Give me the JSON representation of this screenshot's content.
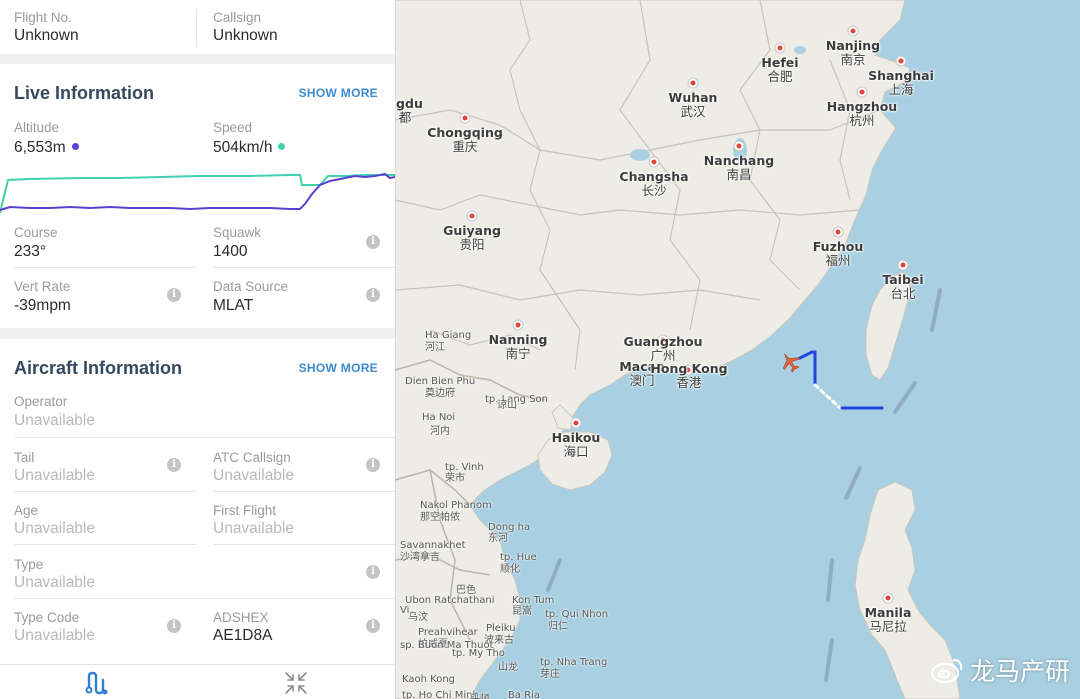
{
  "flight": {
    "flight_no_label": "Flight No.",
    "flight_no_value": "Unknown",
    "callsign_label": "Callsign",
    "callsign_value": "Unknown"
  },
  "live": {
    "title": "Live Information",
    "show_more": "SHOW MORE",
    "altitude_label": "Altitude",
    "altitude_value": "6,553m",
    "speed_label": "Speed",
    "speed_value": "504km/h",
    "altitude_color": "#5b3fd0",
    "speed_color": "#3fd1b0",
    "course_label": "Course",
    "course_value": "233°",
    "squawk_label": "Squawk",
    "squawk_value": "1400",
    "vert_rate_label": "Vert Rate",
    "vert_rate_value": "-39mpm",
    "data_source_label": "Data Source",
    "data_source_value": "MLAT"
  },
  "aircraft": {
    "title": "Aircraft Information",
    "show_more": "SHOW MORE",
    "operator_label": "Operator",
    "operator_value": "Unavailable",
    "tail_label": "Tail",
    "tail_value": "Unavailable",
    "atc_label": "ATC Callsign",
    "atc_value": "Unavailable",
    "age_label": "Age",
    "age_value": "Unavailable",
    "first_flight_label": "First Flight",
    "first_flight_value": "Unavailable",
    "type_label": "Type",
    "type_value": "Unavailable",
    "type_code_label": "Type Code",
    "type_code_value": "Unavailable",
    "adshex_label": "ADSHEX",
    "adshex_value": "AE1D8A"
  },
  "icons": {
    "info": "i",
    "route": "route-icon",
    "collapse": "collapse-icon"
  },
  "map": {
    "cities": [
      {
        "name": "Nanjing",
        "zh": "南京"
      },
      {
        "name": "Hefei",
        "zh": "合肥"
      },
      {
        "name": "Shanghai",
        "zh": "上海"
      },
      {
        "name": "Wuhan",
        "zh": "武汉"
      },
      {
        "name": "Hangzhou",
        "zh": "杭州"
      },
      {
        "name": "Chongqing",
        "zh": "重庆"
      },
      {
        "name": "Nanchang",
        "zh": "南昌"
      },
      {
        "name": "Changsha",
        "zh": "长沙"
      },
      {
        "name": "Guiyang",
        "zh": "贵阳"
      },
      {
        "name": "Fuzhou",
        "zh": "福州"
      },
      {
        "name": "Taibei",
        "zh": "台北"
      },
      {
        "name": "Guangzhou",
        "zh": "广州"
      },
      {
        "name": "Nanning",
        "zh": "南宁"
      },
      {
        "name": "Macao",
        "zh": "澳门"
      },
      {
        "name": "Hong Kong",
        "zh": "香港"
      },
      {
        "name": "Haikou",
        "zh": "海口"
      },
      {
        "name": "Manila",
        "zh": "马尼拉"
      },
      {
        "name": "ngdu",
        "zh": "都"
      }
    ],
    "small_labels": [
      "Ha Giang",
      "河江",
      "Dien Bien Phu",
      "奠边府",
      "Ha Noi",
      "河内",
      "tp. Lang Son",
      "谅山",
      "tp. Vinh",
      "荣市",
      "Nakol Phanom",
      "那空帕侬",
      "Savannakhet",
      "沙湾拿吉",
      "Dong ha",
      "东河",
      "tp. Hue",
      "顺化",
      "Kon Tum",
      "昆嵩",
      "tp. Qui Nhon",
      "归仁",
      "Preahvihear",
      "柏威夏",
      "tp. Nha Trang",
      "芽庄",
      "Kaoh Kong",
      "tp. Ho Chi Minh",
      "Ba Ria",
      "Pleiku",
      "波来古",
      "Ubon Ratchathani",
      "巴色",
      "Vi",
      "tp. My Tho",
      "sp. Buon Ma Thuot",
      "乌汶",
      "山龙",
      "头顿"
    ]
  },
  "watermark": {
    "text": "龙马产研"
  }
}
